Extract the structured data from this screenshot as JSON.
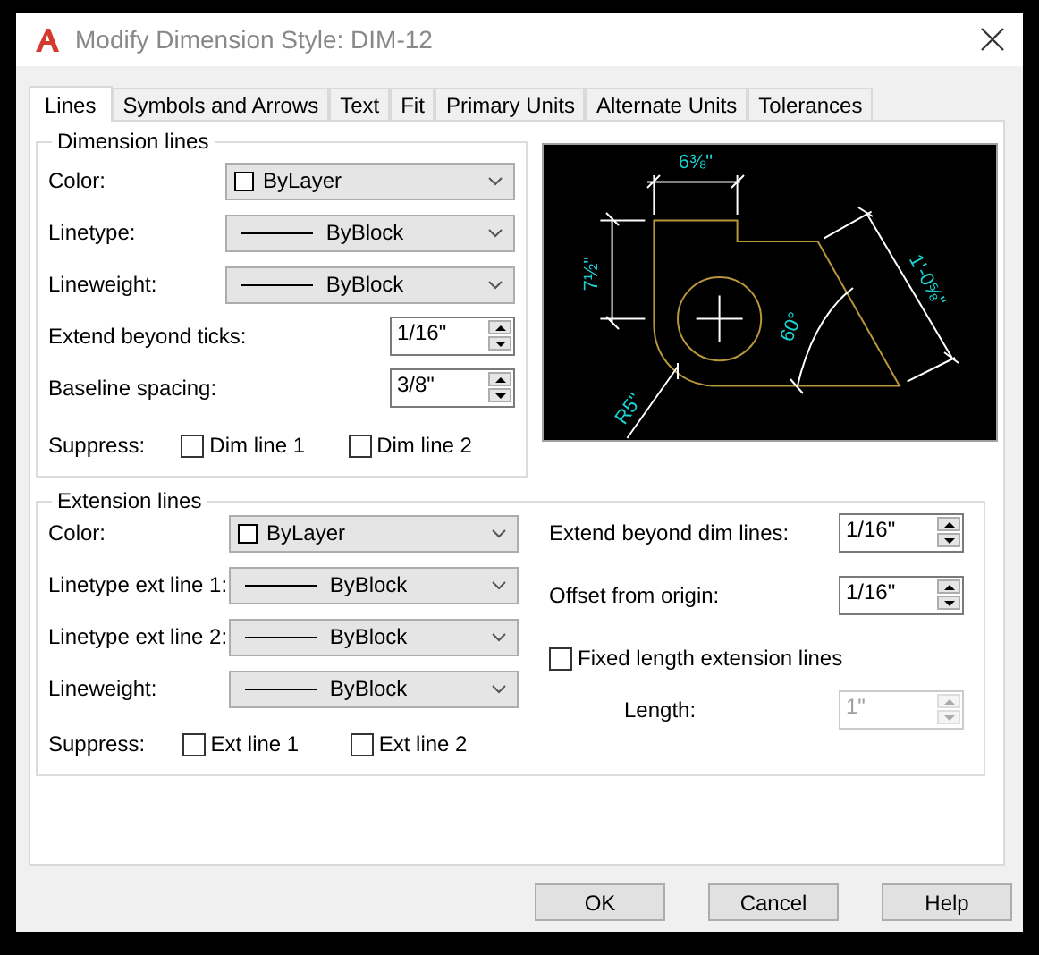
{
  "window": {
    "title": "Modify Dimension Style: DIM-12"
  },
  "tabs": [
    {
      "label": "Lines",
      "selected": true
    },
    {
      "label": "Symbols and Arrows",
      "selected": false
    },
    {
      "label": "Text",
      "selected": false
    },
    {
      "label": "Fit",
      "selected": false
    },
    {
      "label": "Primary Units",
      "selected": false
    },
    {
      "label": "Alternate Units",
      "selected": false
    },
    {
      "label": "Tolerances",
      "selected": false
    }
  ],
  "dimension_lines": {
    "title": "Dimension lines",
    "rows": [
      {
        "kind": "color",
        "label": "Color:",
        "value": "ByLayer"
      },
      {
        "kind": "linetype",
        "label": "Linetype:",
        "value": "ByBlock"
      },
      {
        "kind": "linetype",
        "label": "Lineweight:",
        "value": "ByBlock"
      },
      {
        "kind": "spinner",
        "label": "Extend beyond ticks:",
        "value": "1/16\"",
        "disabled": false
      },
      {
        "kind": "spinner",
        "label": "Baseline spacing:",
        "value": "3/8\"",
        "disabled": false
      }
    ],
    "suppress": {
      "label": "Suppress:",
      "options": [
        {
          "label": "Dim line 1",
          "checked": false
        },
        {
          "label": "Dim line 2",
          "checked": false
        }
      ]
    }
  },
  "preview": {
    "labels": [
      "6⅜\"",
      "7½\"",
      "1'-0⅝\"",
      "60°",
      "R5\""
    ]
  },
  "extension_lines": {
    "title": "Extension lines",
    "rows": [
      {
        "kind": "color",
        "label": "Color:",
        "value": "ByLayer"
      },
      {
        "kind": "linetype",
        "label": "Linetype ext line 1:",
        "value": "ByBlock"
      },
      {
        "kind": "linetype",
        "label": "Linetype ext line 2:",
        "value": "ByBlock"
      },
      {
        "kind": "linetype",
        "label": "Lineweight:",
        "value": "ByBlock"
      }
    ],
    "suppress": {
      "label": "Suppress:",
      "options": [
        {
          "label": "Ext line 1",
          "checked": false
        },
        {
          "label": "Ext line 2",
          "checked": false
        }
      ]
    },
    "right_rows": [
      {
        "kind": "spinner",
        "label": "Extend beyond dim lines:",
        "value": "1/16\"",
        "disabled": false
      },
      {
        "kind": "spinner",
        "label": "Offset from origin:",
        "value": "1/16\"",
        "disabled": false
      },
      {
        "kind": "checkbox",
        "label": "Fixed length extension lines",
        "checked": false,
        "children": [
          {
            "kind": "spinner",
            "label": "Length:",
            "value": "1\"",
            "disabled": true
          }
        ]
      }
    ]
  },
  "buttons": [
    "OK",
    "Cancel",
    "Help"
  ]
}
